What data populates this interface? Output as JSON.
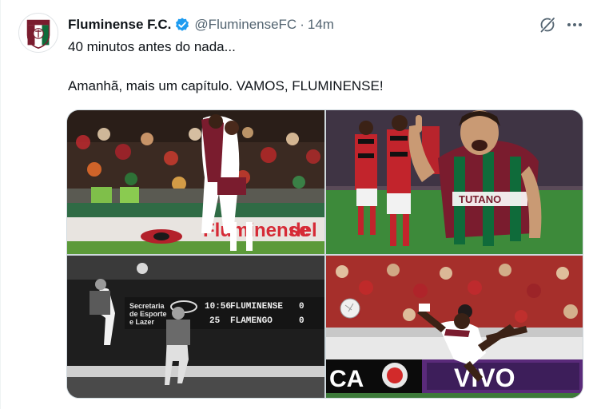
{
  "author": {
    "name": "Fluminense F.C.",
    "handle": "@FluminenseFC",
    "separator": "·",
    "time": "14m",
    "verified": true,
    "avatar_icon": "fluminense-crest"
  },
  "tweet": {
    "line1": "40 minutos antes do nada...",
    "line2": "Amanhã, mais um capítulo. VAMOS, FLUMINENSE!"
  },
  "actions": {
    "grok_icon": "grok-icon",
    "more_icon": "more-options-icon"
  },
  "media": {
    "photo1": {
      "board": "Fluminense",
      "board_suffix": "del"
    },
    "photo2": {
      "shirt": "TUTANO"
    },
    "photo3": {
      "board_left": [
        "Secretaria",
        "de Esporte",
        "e Lazer"
      ],
      "row1": {
        "time": "10:56",
        "team": "FLUMINENSE",
        "score": "0"
      },
      "row2": {
        "time": "25",
        "team": "FLAMENGO",
        "score": "0"
      }
    },
    "photo4": {
      "sponsor_left": "CA",
      "sponsor_right": "VIVO"
    }
  },
  "colors": {
    "fluminense_grena": "#7a1c2e",
    "fluminense_green": "#0f6b3a",
    "verified_blue": "#1d9bf0",
    "secondary_text": "#536471"
  }
}
